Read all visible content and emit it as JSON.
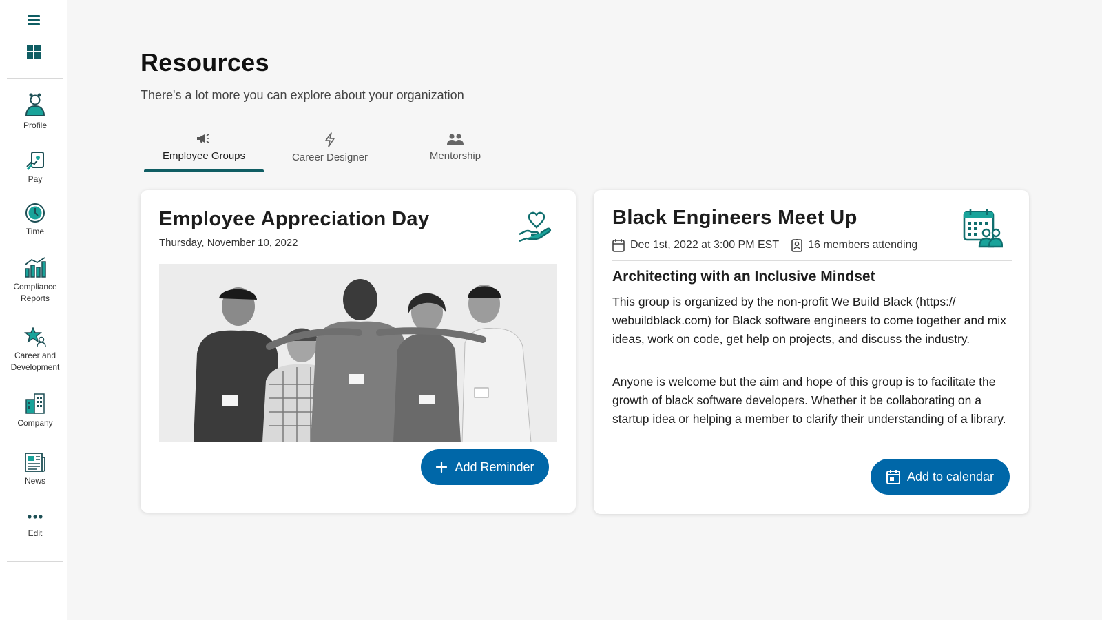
{
  "sidebar": {
    "items": [
      {
        "key": "profile",
        "label": "Profile",
        "icon": "profile-icon"
      },
      {
        "key": "pay",
        "label": "Pay",
        "icon": "pay-icon"
      },
      {
        "key": "time",
        "label": "Time",
        "icon": "time-icon"
      },
      {
        "key": "compliance",
        "label": "Compliance Reports",
        "icon": "chart-icon"
      },
      {
        "key": "career",
        "label": "Career and Development",
        "icon": "star-person-icon"
      },
      {
        "key": "company",
        "label": "Company",
        "icon": "building-icon"
      },
      {
        "key": "news",
        "label": "News",
        "icon": "newspaper-icon"
      },
      {
        "key": "edit",
        "label": "Edit",
        "icon": "more-dots-icon"
      }
    ]
  },
  "header": {
    "title": "Resources",
    "subtitle": "There's a lot more you can explore about your organization"
  },
  "tabs": [
    {
      "label": "Employee Groups",
      "icon": "megaphone-icon",
      "active": true
    },
    {
      "label": "Career Designer",
      "icon": "lightning-icon",
      "active": false
    },
    {
      "label": "Mentorship",
      "icon": "people-icon",
      "active": false
    }
  ],
  "cards": {
    "appreciation": {
      "title": "Employee Appreciation Day",
      "date": "Thursday, November 10, 2022",
      "icon": "heart-hand-icon",
      "button_label": "Add Reminder"
    },
    "meetup": {
      "title": "Black Engineers Meet Up",
      "date_time": "Dec 1st, 2022 at 3:00 PM EST",
      "attending": "16 members attending",
      "icon": "calendar-people-icon",
      "heading": "Architecting with an Inclusive Mindset",
      "paragraph1": "This group is organized by the non-profit We Build Black (https:// webuildblack.com) for Black software engineers to come together and mix ideas, work on code, get help on projects, and discuss the industry.",
      "paragraph2": "Anyone is welcome but the aim and hope of this group is to facilitate the growth of black software developers. Whether it be collaborating on a startup idea or helping a member to clarify their understanding of a library.",
      "button_label": "Add to calendar"
    }
  },
  "colors": {
    "accent": "#0f5d63",
    "button": "#0067a8",
    "icon_teal": "#0f6e6e",
    "background": "#f6f6f6"
  }
}
